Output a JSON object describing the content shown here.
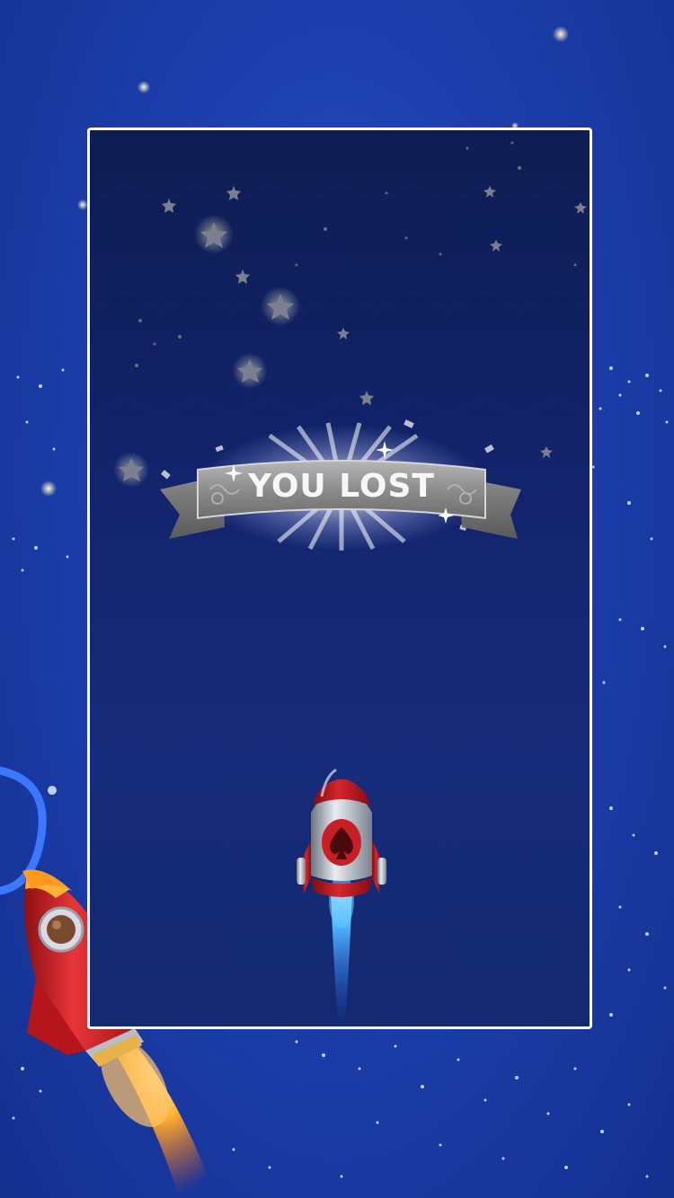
{
  "result_banner": {
    "text": "YOU LOST",
    "icon": "ribbon-banner-icon"
  },
  "player_rocket": {
    "icon": "spade-rocket-icon",
    "emblem": "spade-icon"
  },
  "decor_rocket": {
    "icon": "red-rocket-icon"
  },
  "colors": {
    "background": "#1d3fae",
    "game_panel": "#12236a",
    "frame_border": "#ffffff",
    "banner": "#8f8f8f",
    "rocket_red": "#c2262b",
    "flame": "#ff8a1e"
  }
}
